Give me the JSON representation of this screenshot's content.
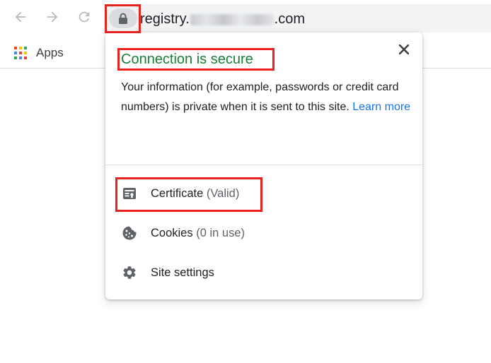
{
  "toolbar": {
    "back_icon": "arrow-back-icon",
    "forward_icon": "arrow-forward-icon",
    "reload_icon": "reload-icon",
    "lock_icon": "lock-icon",
    "url_prefix": "registry.",
    "url_suffix": ".com"
  },
  "bookmarks": {
    "apps_label": "Apps",
    "apps_icon": "apps-grid-icon",
    "apps_colors": [
      "#ea4335",
      "#fbbc04",
      "#34a853",
      "#4285f4",
      "#ea4335",
      "#fbbc04",
      "#34a853",
      "#4285f4",
      "#ea4335"
    ]
  },
  "popup": {
    "title": "Connection is secure",
    "description": "Your information (for example, passwords or credit card numbers) is private when it is sent to this site.",
    "learn_more": "Learn more",
    "close_icon": "close-icon",
    "items": [
      {
        "label": "Certificate",
        "sub": "(Valid)",
        "icon": "certificate-icon"
      },
      {
        "label": "Cookies",
        "sub": "(0 in use)",
        "icon": "cookie-icon"
      },
      {
        "label": "Site settings",
        "sub": "",
        "icon": "gear-icon"
      }
    ]
  },
  "colors": {
    "secure_green": "#188038",
    "link_blue": "#1a73e8",
    "highlight_red": "#e8231f"
  }
}
